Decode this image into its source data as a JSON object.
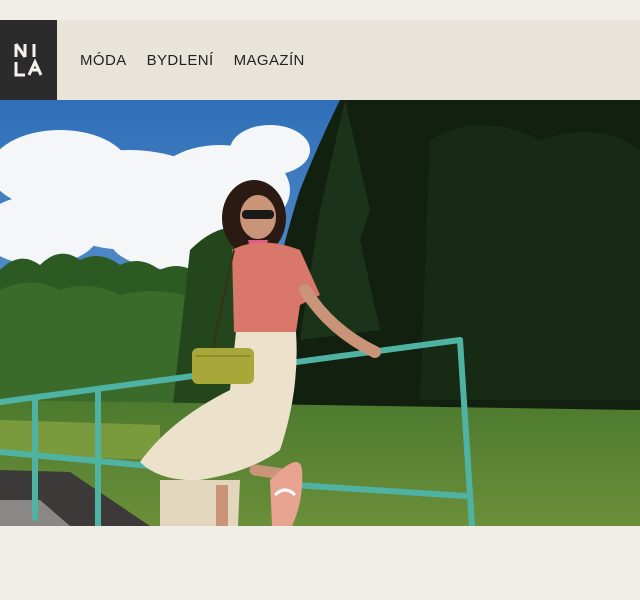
{
  "brand": {
    "logo_text": "NILA",
    "logo_icon": "nila-monogram-icon"
  },
  "nav": {
    "items": [
      {
        "label": "MÓDA"
      },
      {
        "label": "BYDLENÍ"
      },
      {
        "label": "MAGAZÍN"
      }
    ]
  },
  "hero": {
    "image": "woman-sitting-on-railing-photo"
  },
  "colors": {
    "header_bg": "#e9e4d9",
    "logo_bg": "#2b2b2b",
    "page_bg": "#f1eee8",
    "railing": "#4fb3a4"
  }
}
